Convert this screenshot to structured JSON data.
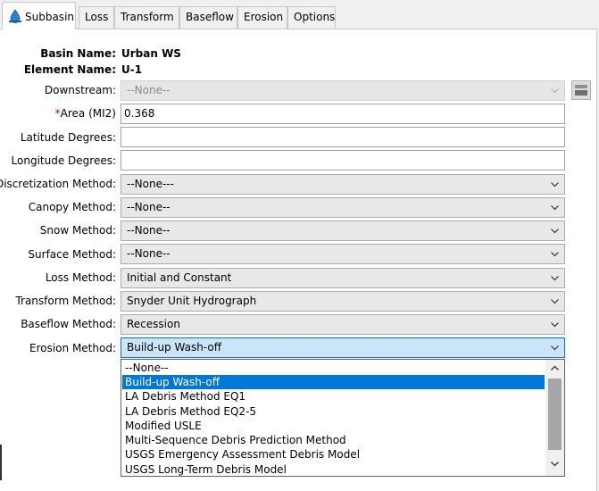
{
  "tabs": [
    {
      "label": "Subbasin"
    },
    {
      "label": "Loss"
    },
    {
      "label": "Transform"
    },
    {
      "label": "Baseflow"
    },
    {
      "label": "Erosion"
    },
    {
      "label": "Options"
    }
  ],
  "basin": {
    "label": "Basin Name:",
    "value": "Urban WS"
  },
  "element": {
    "label": "Element Name:",
    "value": "U-1"
  },
  "downstream": {
    "label": "Downstream:",
    "value": "--None--"
  },
  "area": {
    "required": "*",
    "label": "Area (MI2)",
    "value": "0.368"
  },
  "latitude": {
    "label": "Latitude Degrees:",
    "value": ""
  },
  "longitude": {
    "label": "Longitude Degrees:",
    "value": ""
  },
  "discretization": {
    "label": "Discretization Method:",
    "value": "--None---"
  },
  "canopy": {
    "label": "Canopy Method:",
    "value": "--None--"
  },
  "snow": {
    "label": "Snow Method:",
    "value": "--None--"
  },
  "surface": {
    "label": "Surface Method:",
    "value": "--None--"
  },
  "loss": {
    "label": "Loss Method:",
    "value": "Initial and Constant"
  },
  "transform": {
    "label": "Transform Method:",
    "value": "Snyder Unit Hydrograph"
  },
  "baseflow": {
    "label": "Baseflow Method:",
    "value": "Recession"
  },
  "erosion": {
    "label": "Erosion Method:",
    "value": "Build-up Wash-off"
  },
  "erosion_options": [
    "--None--",
    "Build-up Wash-off",
    "LA Debris Method EQ1",
    "LA Debris Method EQ2-5",
    "Modified USLE",
    "Multi-Sequence Debris Prediction Method",
    "USGS Emergency Assessment Debris Model",
    "USGS Long-Term Debris Model"
  ],
  "colors": {
    "accent": "#0078d7",
    "required": "#e00000",
    "focus_bg": "#cce4f7"
  }
}
